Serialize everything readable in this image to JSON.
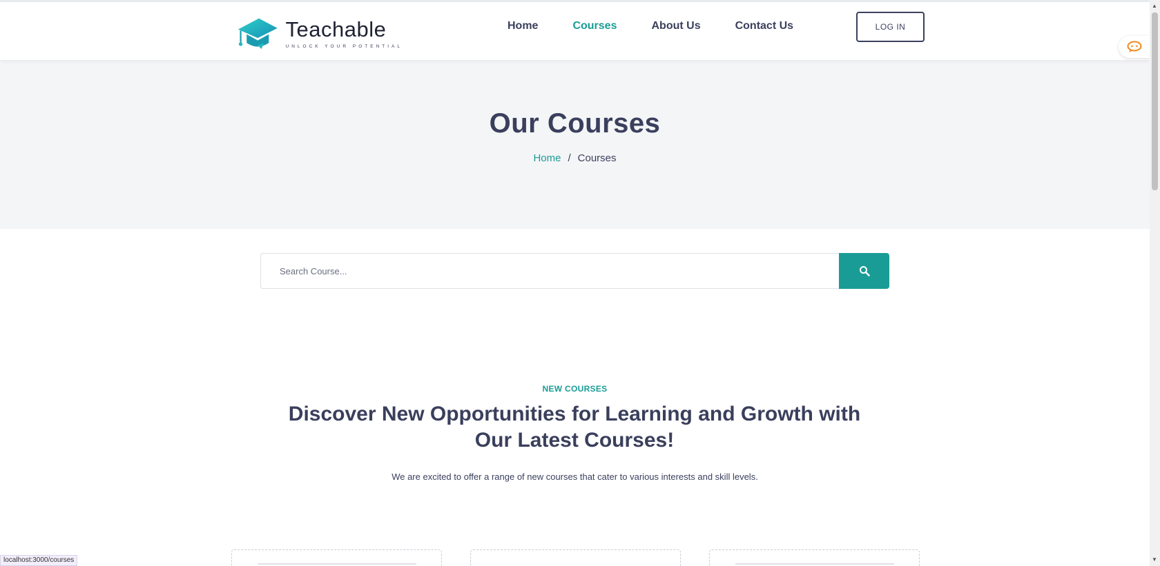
{
  "brand": {
    "name": "Teachable",
    "tagline": "UNLOCK YOUR POTENTIAL",
    "logo_icon": "graduation-cap-icon",
    "primary_color": "#1a9c96"
  },
  "nav": {
    "items": [
      {
        "label": "Home",
        "active": false
      },
      {
        "label": "Courses",
        "active": true
      },
      {
        "label": "About Us",
        "active": false
      },
      {
        "label": "Contact Us",
        "active": false
      }
    ],
    "login_label": "LOG IN"
  },
  "hero": {
    "title": "Our Courses",
    "breadcrumb": {
      "home": "Home",
      "separator": "/",
      "current": "Courses"
    }
  },
  "search": {
    "placeholder": "Search Course...",
    "button_icon": "search-icon"
  },
  "section": {
    "kicker": "NEW COURSES",
    "title": "Discover New Opportunities for Learning and Growth with Our Latest Courses!",
    "description": "We are excited to offer a range of new courses that cater to various interests and skill levels."
  },
  "status_bar": {
    "url": "localhost:3000/courses"
  },
  "widgets": {
    "chat_icon": "chat-bubble-icon"
  }
}
